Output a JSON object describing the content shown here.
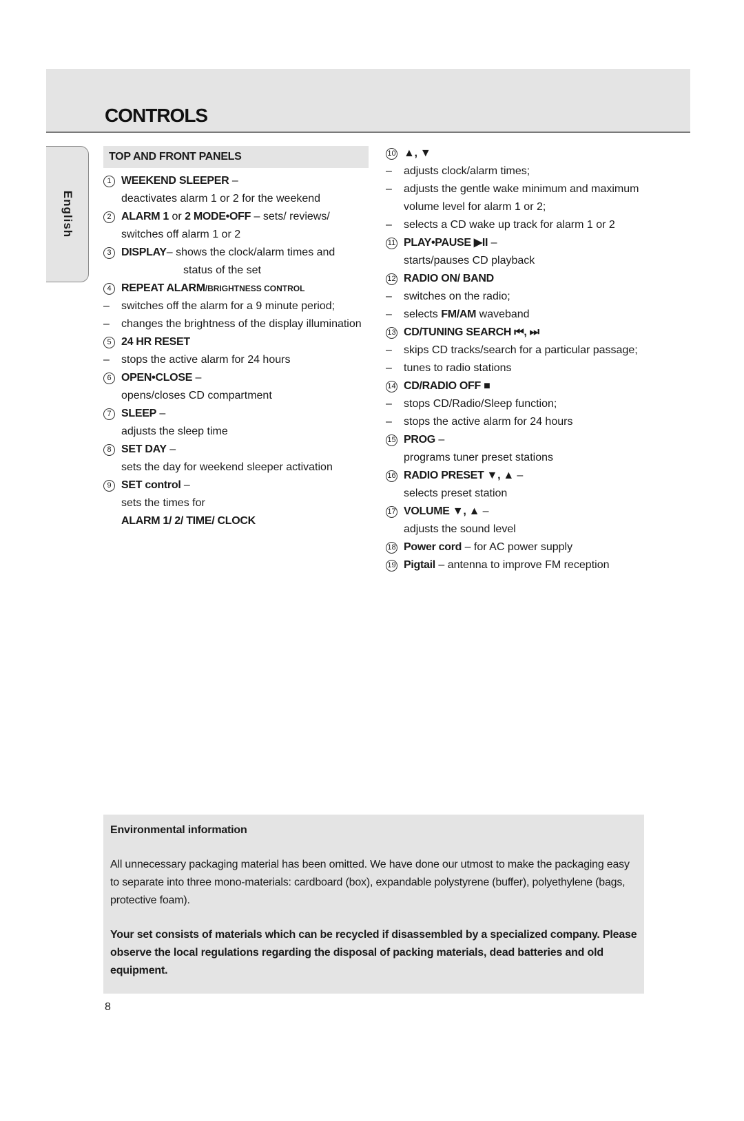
{
  "page": {
    "title": "CONTROLS",
    "language_tab": "English",
    "page_number": "8"
  },
  "left_column": {
    "section_title": "TOP AND FRONT PANELS",
    "items": [
      {
        "num": "1",
        "label": "WEEKEND SLEEPER",
        "suffix": " –",
        "desc": "deactivates alarm 1 or 2 for the weekend"
      },
      {
        "num": "2",
        "label_a": "ALARM 1",
        "mid": " or ",
        "label_b": "2 MODE•OFF",
        "suffix": " – sets/ reviews/",
        "desc": "switches off alarm 1 or 2"
      },
      {
        "num": "3",
        "label": "DISPLAY",
        "suffix": "– shows the clock/alarm times and",
        "desc": "status of the set"
      },
      {
        "num": "4",
        "label": "REPEAT ALARM",
        "label_small": "/BRIGHTNESS CONTROL",
        "bullets": [
          "switches off the alarm for a 9 minute period;",
          "changes the brightness of the display illumination"
        ]
      },
      {
        "num": "5",
        "label": "24 HR RESET",
        "bullets": [
          "stops the active alarm for 24 hours"
        ]
      },
      {
        "num": "6",
        "label": "OPEN•CLOSE",
        "suffix": " –",
        "desc": "opens/closes CD compartment"
      },
      {
        "num": "7",
        "label": "SLEEP",
        "suffix": " –",
        "desc": "adjusts the sleep time"
      },
      {
        "num": "8",
        "label": "SET DAY",
        "suffix": " –",
        "desc": "sets the day for weekend sleeper activation"
      },
      {
        "num": "9",
        "label": "SET control",
        "suffix": " –",
        "desc": "sets the times for",
        "desc_bold": "ALARM 1/ 2/ TIME/ CLOCK"
      }
    ]
  },
  "right_column": {
    "items": [
      {
        "num": "10",
        "label": "▲, ▼",
        "bullets": [
          "adjusts clock/alarm times;",
          "adjusts the gentle wake minimum and maximum volume level for alarm 1 or 2;",
          "selects a CD wake up track for alarm 1 or 2"
        ]
      },
      {
        "num": "11",
        "label": "PLAY•PAUSE ▶II",
        "suffix": " –",
        "desc": "starts/pauses CD playback"
      },
      {
        "num": "12",
        "label": "RADIO ON/ BAND",
        "bullets": [
          "switches on the radio;"
        ],
        "bullet_mixed": {
          "pre": "selects ",
          "bold": "FM/AM",
          "post": " waveband"
        }
      },
      {
        "num": "13",
        "label": "CD/TUNING SEARCH ⏮, ⏭",
        "bullets": [
          "skips CD tracks/search for a particular passage;",
          "tunes to radio stations"
        ]
      },
      {
        "num": "14",
        "label": "CD/RADIO OFF ■",
        "bullets": [
          "stops CD/Radio/Sleep function;",
          "stops the active alarm for 24 hours"
        ]
      },
      {
        "num": "15",
        "label": "PROG",
        "suffix": " –",
        "desc": "programs tuner preset stations"
      },
      {
        "num": "16",
        "label": "RADIO PRESET ▼, ▲",
        "suffix": " –",
        "desc": "selects preset station"
      },
      {
        "num": "17",
        "label": "VOLUME ▼, ▲",
        "suffix": " –",
        "desc": "adjusts the sound level"
      },
      {
        "num": "18",
        "label": "Power cord",
        "suffix": " – for AC power supply"
      },
      {
        "num": "19",
        "label": "Pigtail",
        "suffix": " – antenna to improve FM reception"
      }
    ]
  },
  "environment": {
    "title": "Environmental information",
    "paragraph": "All unnecessary packaging material has been omitted. We have done our utmost to make the packaging easy to separate into three mono-materials: cardboard (box), expandable polystyrene (buffer), polyethylene (bags, protective foam).",
    "bold_paragraph": "Your set consists of materials which can be recycled if disassembled by a specialized company. Please observe the local regulations regarding the disposal of packing materials, dead batteries and old equipment."
  }
}
